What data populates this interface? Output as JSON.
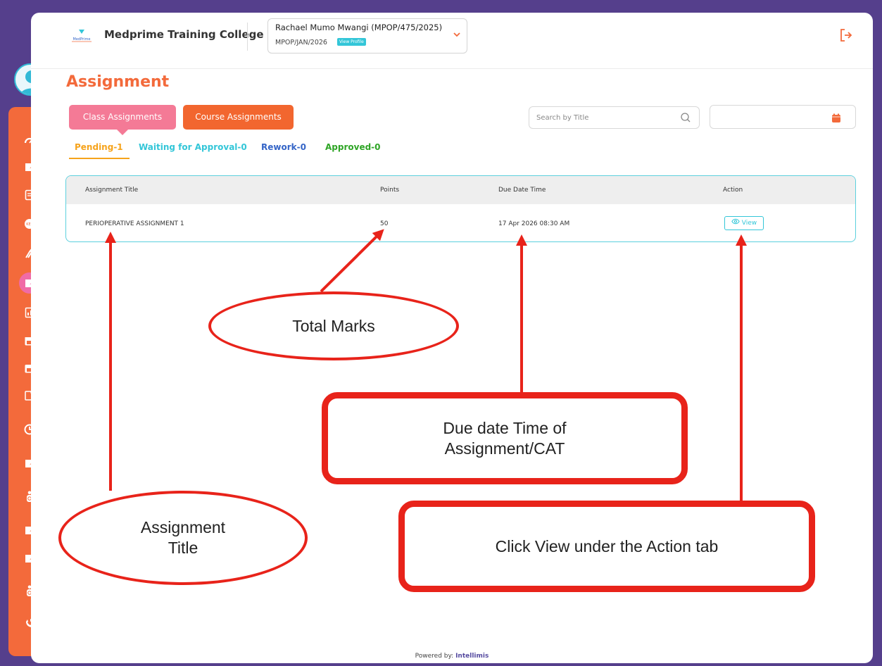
{
  "header": {
    "college_name": "Medprime Training College",
    "student_name": "Rachael Mumo Mwangi (MPOP/475/2025)",
    "cohort": "MPOP/JAN/2026",
    "view_profile_label": "View Profile"
  },
  "page": {
    "title": "Assignment"
  },
  "assignment_type_buttons": {
    "class": "Class Assignments",
    "course": "Course Assignments"
  },
  "search": {
    "placeholder": "Search by Title"
  },
  "status_tabs": {
    "pending": "Pending-1",
    "waiting": "Waiting for Approval-0",
    "rework": "Rework-0",
    "approved": "Approved-0"
  },
  "table": {
    "headers": [
      "Assignment Title",
      "Points",
      "Due Date Time",
      "Action"
    ],
    "rows": [
      {
        "title": "PERIOPERATIVE ASSIGNMENT 1",
        "points": "50",
        "due": "17 Apr 2026 08:30 AM",
        "action": "View"
      }
    ]
  },
  "footer": {
    "label": "Powered by:",
    "brand": "Intellimis"
  },
  "annotations": {
    "total_marks": "Total Marks",
    "assignment_title": "Assignment Title",
    "due_date": "Due date Time of Assignment/CAT",
    "click_view": "Click View under the Action tab"
  },
  "colors": {
    "accent": "#f36a3b",
    "pink": "#f47a96",
    "teal": "#33c6d8",
    "annotation_red": "#e8231a",
    "frame": "#553f8c"
  },
  "sidebar_icons": [
    "dashboard-icon",
    "edit-icon",
    "document-icon",
    "kes-fees-icon",
    "graduation-icon",
    "assignment-icon",
    "report-icon",
    "calendar-icon",
    "calendar-icon",
    "exam-icon",
    "clock-icon",
    "edit-icon",
    "clinical-icon",
    "edit-icon",
    "edit-icon",
    "clinical-icon",
    "support-icon"
  ]
}
